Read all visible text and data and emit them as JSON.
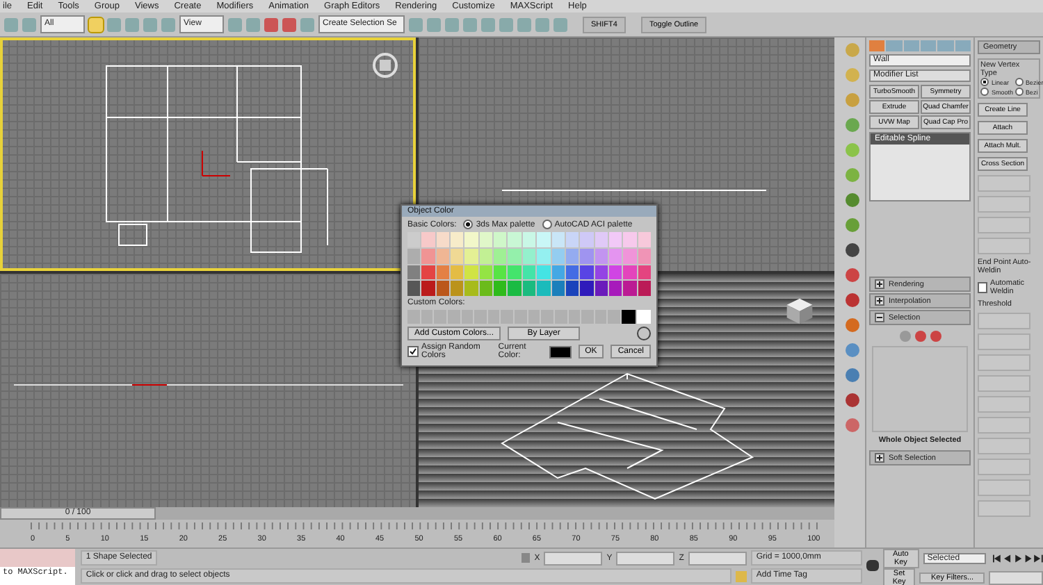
{
  "menu": [
    "ile",
    "Edit",
    "Tools",
    "Group",
    "Views",
    "Create",
    "Modifiers",
    "Animation",
    "Graph Editors",
    "Rendering",
    "Customize",
    "MAXScript",
    "Help"
  ],
  "toolbar": {
    "selection_filter": "All",
    "reference_coordinate": "View",
    "named_selection": "Create Selection Se",
    "buttons": [
      "SHIFT4",
      "Toggle Outline"
    ]
  },
  "command_panel": {
    "object_name": "Wall",
    "modifier_list": "Modifier List",
    "modifier_buttons": [
      "TurboSmooth",
      "Symmetry",
      "Extrude",
      "Quad Chamfer",
      "UVW Map",
      "Quad Cap Pro"
    ],
    "stack": [
      {
        "label": "Editable Spline",
        "selected": true
      }
    ],
    "rollouts": [
      {
        "label": "Rendering",
        "expanded": false
      },
      {
        "label": "Interpolation",
        "expanded": false
      },
      {
        "label": "Selection",
        "expanded": true
      }
    ],
    "selection_status": "Whole Object Selected",
    "soft_selection": {
      "label": "Soft Selection",
      "expanded": false
    }
  },
  "geometry_panel": {
    "title": "Geometry",
    "vertex_type_label": "New Vertex Type",
    "vertex_types": [
      {
        "label": "Linear",
        "selected": true
      },
      {
        "label": "Bezier",
        "selected": false
      },
      {
        "label": "Smooth",
        "selected": false
      },
      {
        "label": "Bezi",
        "selected": false
      }
    ],
    "buttons": [
      "Create Line",
      "Attach",
      "Attach Mult.",
      "Cross Section"
    ],
    "welding_title": "End Point Auto-Weldin",
    "automatic_welding": {
      "label": "Automatic Weldin",
      "checked": false
    },
    "threshold_label": "Threshold"
  },
  "dialog": {
    "title": "Object Color",
    "basic_colors_label": "Basic Colors:",
    "palettes": [
      {
        "label": "3ds Max palette",
        "selected": true
      },
      {
        "label": "AutoCAD ACI palette",
        "selected": false
      }
    ],
    "custom_colors_label": "Custom Colors:",
    "add_custom": "Add Custom Colors...",
    "by_layer": "By Layer",
    "assign_random": {
      "label": "Assign Random Colors",
      "checked": true
    },
    "current_color_label": "Current Color:",
    "ok": "OK",
    "cancel": "Cancel"
  },
  "timeline": {
    "frame": "0 / 100",
    "ticks": [
      "0",
      "5",
      "10",
      "15",
      "20",
      "25",
      "30",
      "35",
      "40",
      "45",
      "50",
      "55",
      "60",
      "65",
      "70",
      "75",
      "80",
      "85",
      "90",
      "95",
      "100"
    ]
  },
  "status_bar": {
    "listener": "to MAXScript.",
    "selection": "1 Shape Selected",
    "prompt": "Click or click and drag to select objects",
    "coords": [
      "X",
      "Y",
      "Z"
    ],
    "grid": "Grid = 1000,0mm",
    "time_tag": "Add Time Tag",
    "auto_key": "Auto Key",
    "key_mode": "Selected",
    "set_key": "Set Key",
    "key_filters": "Key Filters..."
  }
}
